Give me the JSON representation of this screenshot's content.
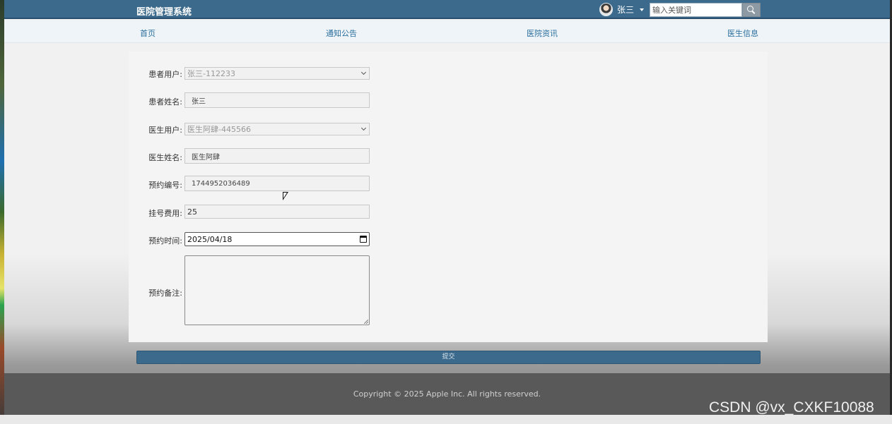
{
  "header": {
    "brand": "医院管理系统",
    "user_name": "张三",
    "search_placeholder": "输入关键词"
  },
  "nav": {
    "items": [
      "首页",
      "通知公告",
      "医院资讯",
      "医生信息"
    ]
  },
  "form": {
    "fields": [
      {
        "label": "患者用户:",
        "value": "张三-112233",
        "kind": "select"
      },
      {
        "label": "患者姓名:",
        "value": "张三",
        "kind": "readonly"
      },
      {
        "label": "医生用户:",
        "value": "医生阿肆-445566",
        "kind": "select"
      },
      {
        "label": "医生姓名:",
        "value": "医生阿肆",
        "kind": "readonly"
      },
      {
        "label": "预约编号:",
        "value": "1744952036489",
        "kind": "readonly"
      },
      {
        "label": "挂号费用:",
        "value": "25",
        "kind": "number"
      },
      {
        "label": "预约时间:",
        "value": "2025/04/18",
        "kind": "date"
      },
      {
        "label": "预约备注:",
        "value": "",
        "kind": "textarea"
      }
    ],
    "submit_label": "提交"
  },
  "footer": {
    "copyright": "Copyright © 2025 Apple Inc. All rights reserved."
  },
  "watermark": "CSDN @vx_CXKF10088",
  "colors": {
    "header_bg": "#3c6a8c",
    "nav_bg": "#eef4f8",
    "nav_link": "#2a6e9e",
    "footer_bg": "#595959"
  }
}
